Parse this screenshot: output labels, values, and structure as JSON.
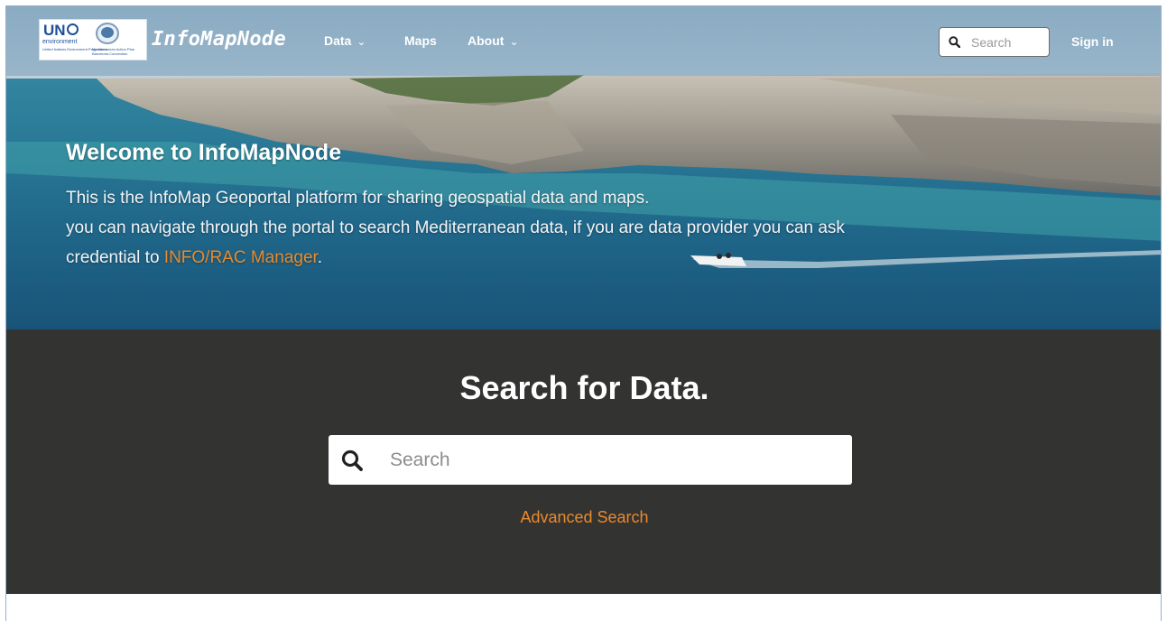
{
  "navbar": {
    "logo_un": "UN",
    "logo_environment": "environment",
    "logo_un_sub": "United Nations Environment Programme",
    "logo_map_sub": "Mediterranean Action Plan Barcelona Convention",
    "brand": "InfoMapNode",
    "items": [
      {
        "label": "Data",
        "dropdown": true
      },
      {
        "label": "Maps",
        "dropdown": false
      },
      {
        "label": "About",
        "dropdown": true
      }
    ],
    "search_placeholder": "Search",
    "signin_label": "Sign in"
  },
  "hero": {
    "title": "Welcome to InfoMapNode",
    "line1": "This is the InfoMap Geoportal platform for sharing geospatial data and maps.",
    "line2": "you can navigate through the portal to search Mediterranean data, if you are data provider you can ask",
    "line3_prefix": "credential to ",
    "line3_link": "INFO/RAC Manager",
    "line3_suffix": "."
  },
  "search": {
    "title": "Search for Data.",
    "placeholder": "Search",
    "advanced_label": "Advanced Search"
  },
  "colors": {
    "accent": "#e98a2c",
    "dark_section": "#333332",
    "navbar_overlay": "rgba(120,160,190,0.55)"
  }
}
